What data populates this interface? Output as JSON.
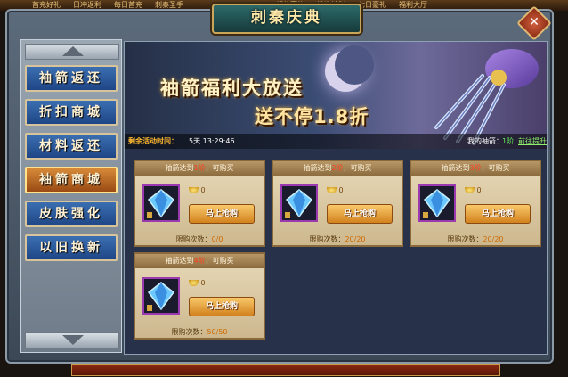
{
  "top_menu": [
    "首充好礼",
    "日冲返利",
    "每日首充",
    "刺秦圣手",
    "超值豪礼",
    "投资计划",
    "七日豪礼",
    "福利大厅"
  ],
  "window": {
    "title": "刺秦庆典",
    "close_symbol": "✕"
  },
  "sidebar": {
    "items": [
      {
        "label": "袖箭返还"
      },
      {
        "label": "折扣商城"
      },
      {
        "label": "材料返还"
      },
      {
        "label": "袖箭商城",
        "active": true
      },
      {
        "label": "皮肤强化"
      },
      {
        "label": "以旧换新"
      }
    ]
  },
  "banner": {
    "headline": "袖箭福利大放送",
    "subline": "送不停1.8折",
    "timer_label": "剩余活动时间：",
    "timer_value": "5天 13:29:46",
    "my_arrows_label": "我的袖箭：",
    "my_arrows_value": "1阶",
    "go_link": "前往提升"
  },
  "cards": [
    {
      "head_prefix": "袖箭达到",
      "head_level": "1阶",
      "head_suffix": "，可购买",
      "price": "0",
      "button": "马上抢购",
      "limit_label": "限购次数：",
      "limit_value": "0/0"
    },
    {
      "head_prefix": "袖箭达到",
      "head_level": "2阶",
      "head_suffix": "，可购买",
      "price": "0",
      "button": "马上抢购",
      "limit_label": "限购次数：",
      "limit_value": "20/20"
    },
    {
      "head_prefix": "袖箭达到",
      "head_level": "3阶",
      "head_suffix": "，可购买",
      "price": "0",
      "button": "马上抢购",
      "limit_label": "限购次数：",
      "limit_value": "20/20"
    },
    {
      "head_prefix": "袖箭达到",
      "head_level": "4阶",
      "head_suffix": "，可购买",
      "price": "0",
      "button": "马上抢购",
      "limit_label": "限购次数：",
      "limit_value": "50/50"
    }
  ],
  "colors": {
    "accent_gold": "#ffe9a8",
    "sidebar_blue": "#2f5c9e",
    "active_orange": "#c8782a",
    "level_red": "#ff4020"
  },
  "icons": [
    "arrow-up-icon",
    "arrow-down-icon",
    "close-icon",
    "gem-icon",
    "ingot-icon",
    "lock-icon",
    "moon-icon",
    "sleeve-arrow-weapon-icon"
  ]
}
